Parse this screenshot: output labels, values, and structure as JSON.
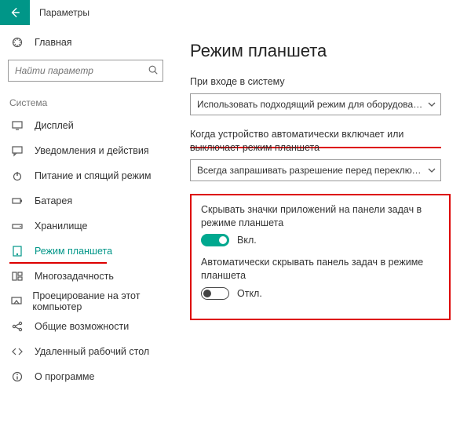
{
  "app_title": "Параметры",
  "home_label": "Главная",
  "search_placeholder": "Найти параметр",
  "section_header": "Система",
  "sidebar": [
    {
      "id": "display",
      "label": "Дисплей"
    },
    {
      "id": "notif",
      "label": "Уведомления и действия"
    },
    {
      "id": "power",
      "label": "Питание и спящий режим"
    },
    {
      "id": "battery",
      "label": "Батарея"
    },
    {
      "id": "storage",
      "label": "Хранилище"
    },
    {
      "id": "tablet",
      "label": "Режим планшета",
      "active": true
    },
    {
      "id": "multitask",
      "label": "Многозадачность"
    },
    {
      "id": "project",
      "label": "Проецирование на этот компьютер"
    },
    {
      "id": "shared",
      "label": "Общие возможности"
    },
    {
      "id": "remote",
      "label": "Удаленный рабочий стол"
    },
    {
      "id": "about",
      "label": "О программе"
    }
  ],
  "page_title": "Режим планшета",
  "field1_label": "При входе в систему",
  "field1_value": "Использовать подходящий режим для оборудования",
  "field2_label": "Когда устройство автоматически включает или выключает режим планшета",
  "field2_value": "Всегда запрашивать разрешение перед переключением...",
  "toggle1_label": "Скрывать значки приложений на панели задач в режиме планшета",
  "toggle1_state": "Вкл.",
  "toggle2_label": "Автоматически скрывать панель задач в режиме планшета",
  "toggle2_state": "Откл."
}
